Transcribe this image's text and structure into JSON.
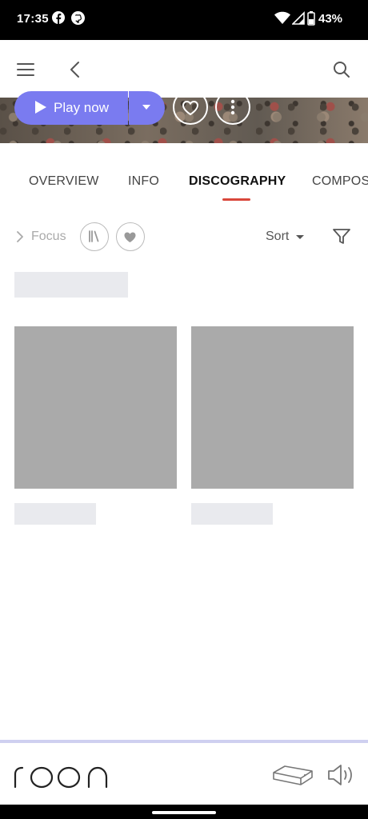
{
  "status_bar": {
    "time": "17:35",
    "battery": "43%",
    "icons": [
      "facebook-icon",
      "github-icon",
      "wifi-icon",
      "signal-icon",
      "battery-icon"
    ]
  },
  "app_bar": {
    "icons": [
      "hamburger-menu-icon",
      "back-arrow-icon",
      "search-icon"
    ]
  },
  "hero": {
    "play_label": "Play now",
    "icons": [
      "play-icon",
      "dropdown-caret-icon",
      "heart-outline-icon",
      "more-vertical-icon"
    ],
    "accent": "#7a7bf0"
  },
  "tabs": {
    "items": [
      "OVERVIEW",
      "INFO",
      "DISCOGRAPHY",
      "COMPOS"
    ],
    "active": "DISCOGRAPHY",
    "underline_color": "#d9473b"
  },
  "toolbar": {
    "focus_label": "Focus",
    "sort_label": "Sort",
    "icons": [
      "chevron-right-icon",
      "library-icon",
      "heart-filled-icon",
      "sort-caret-icon",
      "filter-icon"
    ]
  },
  "bottom_bar": {
    "logo": "roon",
    "icons": [
      "roon-core-device-icon",
      "volume-icon"
    ],
    "accent_line": "#cfd0f0"
  }
}
